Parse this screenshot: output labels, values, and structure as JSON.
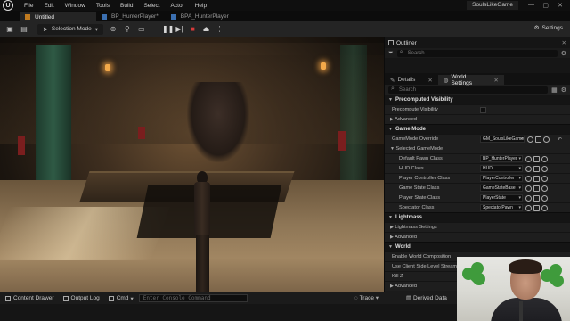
{
  "menubar": {
    "items": [
      "File",
      "Edit",
      "Window",
      "Tools",
      "Build",
      "Select",
      "Actor",
      "Help"
    ],
    "project_name": "SoulsLikeGame",
    "controls": [
      "—",
      "▢",
      "✕"
    ]
  },
  "tabs": [
    {
      "label": "Untitled",
      "active": true
    },
    {
      "label": "BP_HunterPlayer*",
      "active": false
    },
    {
      "label": "BPA_HunterPlayer",
      "active": false
    }
  ],
  "toolbar": {
    "selection_mode": "Selection Mode",
    "settings": "Settings"
  },
  "outliner": {
    "title": "Outliner",
    "search_placeholder": "Search"
  },
  "details_tabs": [
    {
      "label": "Details",
      "active": false
    },
    {
      "label": "World Settings",
      "active": true
    }
  ],
  "details": {
    "search_placeholder": "Search",
    "sections": {
      "precomputed_visibility": "Precomputed Visibility",
      "game_mode": "Game Mode",
      "selected_gamemode": "Selected GameMode",
      "lightmass": "Lightmass",
      "world": "World"
    },
    "rows": {
      "precompute_visibility": "Precompute Visibility",
      "advanced_1": "Advanced",
      "gamemode_override": "GameMode Override",
      "gamemode_override_val": "GM_SoulsLikeGame",
      "default_pawn": "Default Pawn Class",
      "default_pawn_val": "BP_HunterPlayer",
      "hud": "HUD Class",
      "hud_val": "HUD",
      "player_controller": "Player Controller Class",
      "player_controller_val": "PlayerController",
      "game_state": "Game State Class",
      "game_state_val": "GameStateBase",
      "player_state": "Player State Class",
      "player_state_val": "PlayerState",
      "spectator": "Spectator Class",
      "spectator_val": "SpectatorPawn",
      "lightmass_settings": "Lightmass Settings",
      "advanced_2": "Advanced",
      "enable_world_composition": "Enable World Composition",
      "use_client_side": "Use Client Side Level Streaming Volum",
      "kill_z": "Kill Z",
      "advanced_3": "Advanced"
    }
  },
  "bottombar": {
    "content_drawer": "Content Drawer",
    "output_log": "Output Log",
    "cmd": "Cmd",
    "console_placeholder": "Enter Console Command",
    "trace": "Trace",
    "derived_data": "Derived Data"
  }
}
